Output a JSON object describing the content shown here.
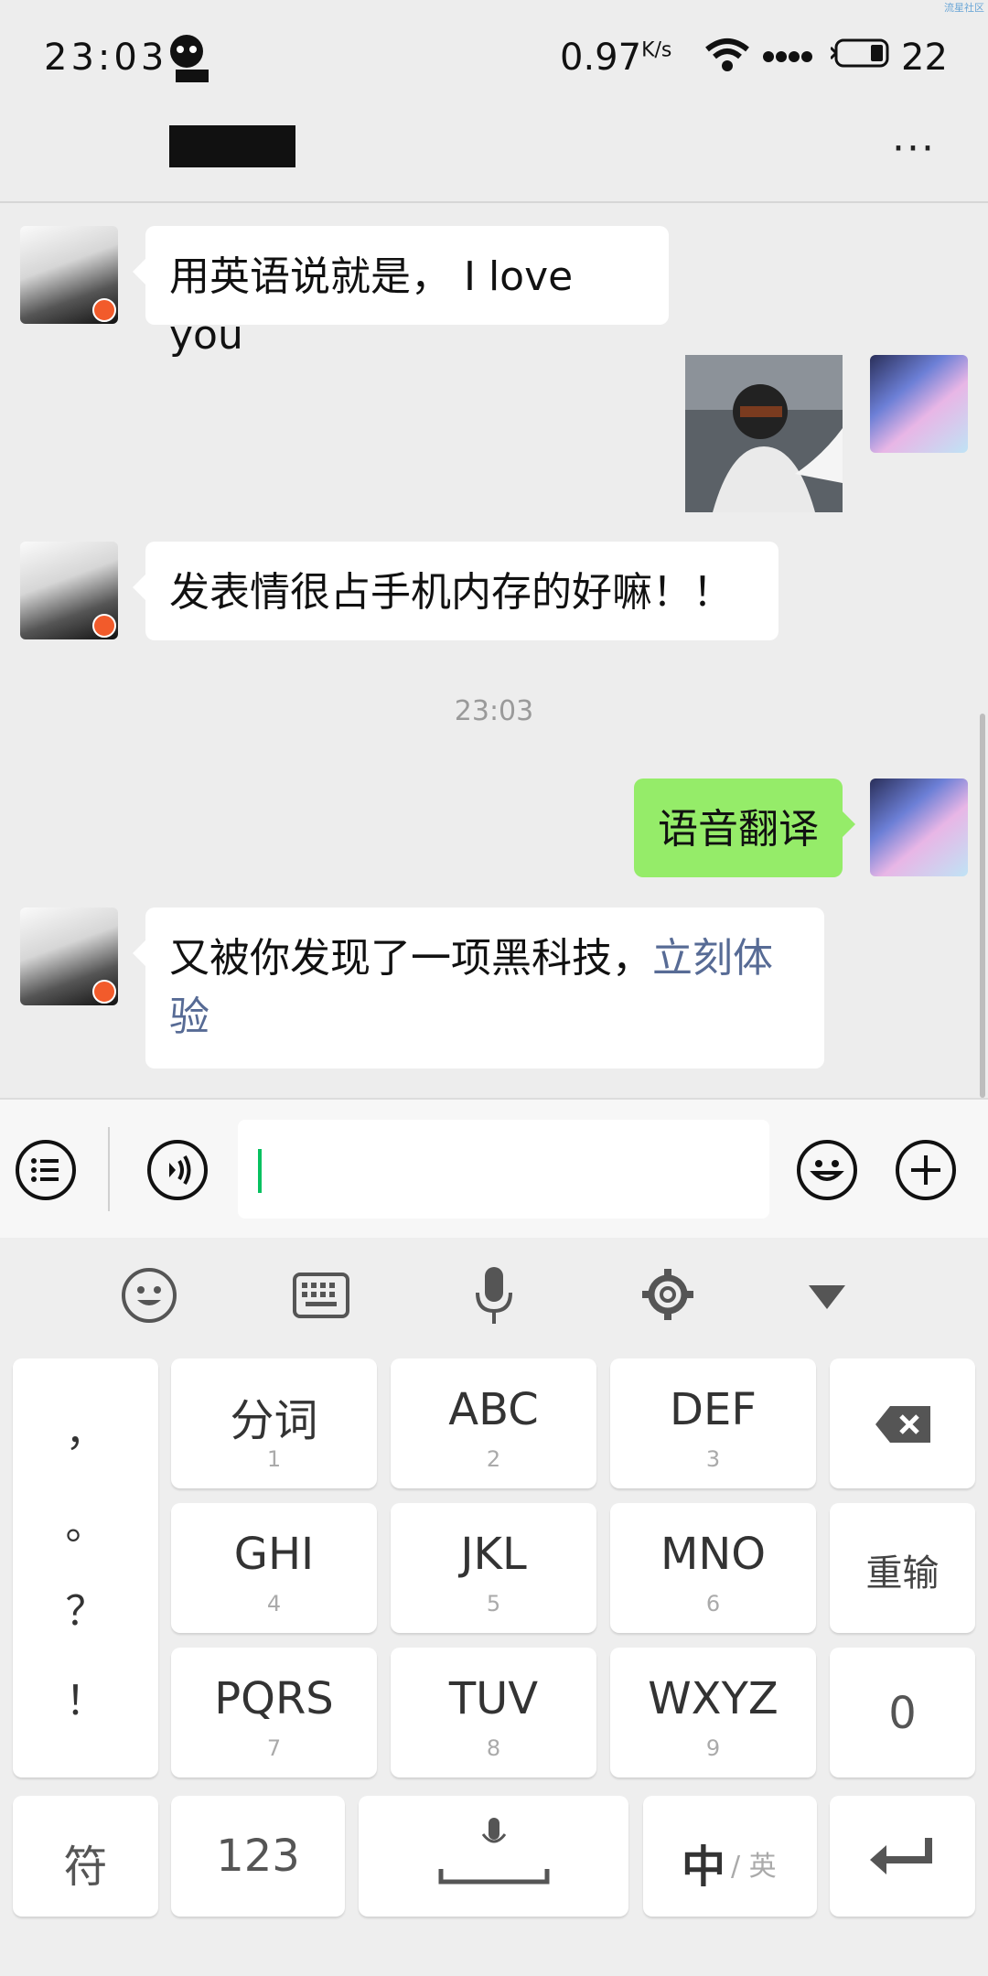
{
  "status_bar": {
    "time": "23:03",
    "speed": "0.97",
    "speed_unit": "K/s",
    "battery": "22",
    "watermark": "流星社区"
  },
  "header": {
    "more_label": "···"
  },
  "messages": [
    {
      "side": "left",
      "text": "用英语说就是， I love you"
    },
    {
      "side": "right",
      "type": "image"
    },
    {
      "side": "left",
      "text": "发表情很占手机内存的好嘛！！"
    },
    {
      "type": "timestamp",
      "text": "23:03"
    },
    {
      "side": "right",
      "text": "语音翻译"
    },
    {
      "side": "left",
      "text": "又被你发现了一项黑科技，",
      "link": "立刻体验"
    }
  ],
  "input_bar": {
    "icons": [
      "list-icon",
      "voice-icon",
      "emoji-icon",
      "plus-icon"
    ],
    "input_value": ""
  },
  "keyboard": {
    "toolbar": [
      "emoji-icon",
      "keyboard-icon",
      "mic-icon",
      "gear-icon",
      "collapse-icon"
    ],
    "punctuation": [
      "，",
      "。",
      "？",
      "！"
    ],
    "keys": [
      {
        "main": "分词",
        "sub": "1"
      },
      {
        "main": "ABC",
        "sub": "2"
      },
      {
        "main": "DEF",
        "sub": "3"
      },
      {
        "main": "GHI",
        "sub": "4"
      },
      {
        "main": "JKL",
        "sub": "5"
      },
      {
        "main": "MNO",
        "sub": "6"
      },
      {
        "main": "PQRS",
        "sub": "7"
      },
      {
        "main": "TUV",
        "sub": "8"
      },
      {
        "main": "WXYZ",
        "sub": "9"
      }
    ],
    "right_keys": {
      "reenter": "重输",
      "zero": "0"
    },
    "bottom_row": {
      "symbol": "符",
      "numbers": "123",
      "lang_main": "中",
      "lang_sub": "/ 英"
    }
  }
}
